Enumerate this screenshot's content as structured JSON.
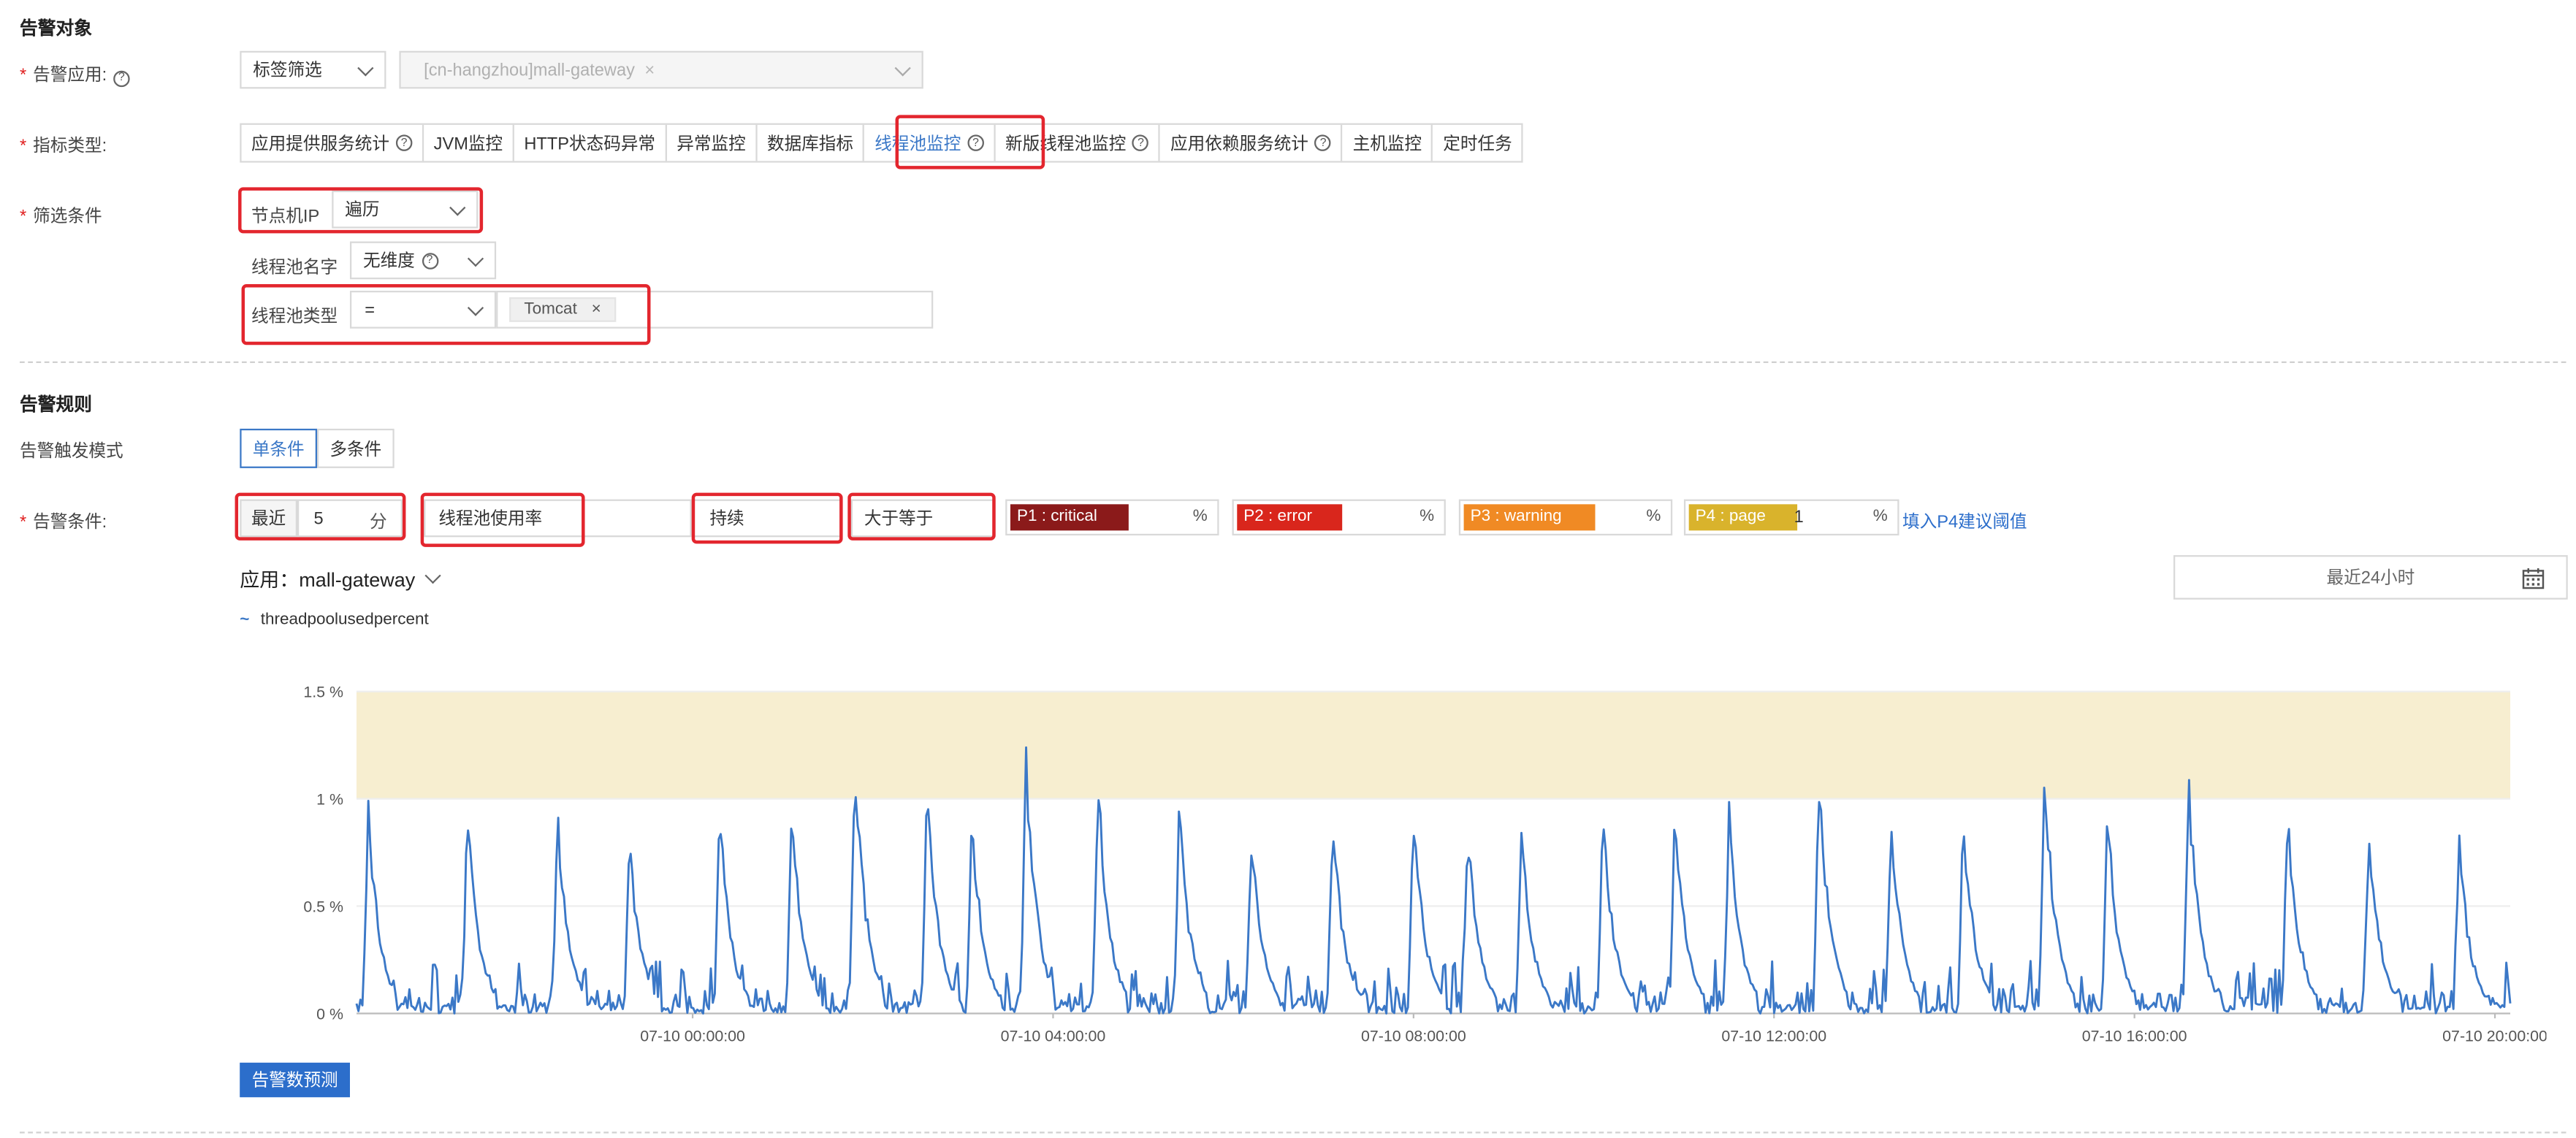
{
  "sections": {
    "target_title": "告警对象",
    "rules_title": "告警规则"
  },
  "target": {
    "app_label": "告警应用:",
    "tag_filter": "标签筛选",
    "app_select": "[cn-hangzhou]mall-gateway",
    "metric_type_label": "指标类型:",
    "metric_tabs": [
      "应用提供服务统计",
      "JVM监控",
      "HTTP状态码异常",
      "异常监控",
      "数据库指标",
      "线程池监控",
      "新版线程池监控",
      "应用依赖服务统计",
      "主机监控",
      "定时任务"
    ],
    "active_tab": "线程池监控",
    "filter_label": "筛选条件",
    "filters": [
      {
        "name": "节点机IP",
        "value": "遍历"
      },
      {
        "name": "线程池名字",
        "value": "无维度"
      },
      {
        "name": "线程池类型",
        "value": "=",
        "tag": "Tomcat"
      }
    ]
  },
  "rules": {
    "trigger_mode_label": "告警触发模式",
    "mode_single": "单条件",
    "mode_multi": "多条件",
    "condition_label": "告警条件:",
    "recent": "最近",
    "recent_value": "5",
    "recent_unit": "分钟",
    "metric": "线程池使用率",
    "duration": "持续",
    "operator": "大于等于",
    "severities": [
      {
        "tag": "P1 : critical",
        "value": "",
        "unit": "%",
        "color": "#8b1a1a"
      },
      {
        "tag": "P2 : error",
        "value": "",
        "unit": "%",
        "color": "#d9261c"
      },
      {
        "tag": "P3 : warning",
        "value": "",
        "unit": "%",
        "color": "#f08a24"
      },
      {
        "tag": "P4 : page",
        "value": "1",
        "unit": "%",
        "color": "#d9b32c"
      }
    ],
    "p4_link": "填入P4建议阈值"
  },
  "chart_header": {
    "app_prefix": "应用：",
    "app_name": "mall-gateway",
    "time_range": "最近24小时"
  },
  "predict_button": "告警数预测",
  "chart_data": {
    "type": "line",
    "series": [
      {
        "name": "threadpoolusedpercent",
        "color": "#3b78c7"
      }
    ],
    "y_ticks": [
      "0 %",
      "0.5 %",
      "1 %",
      "1.5 %"
    ],
    "ylim": [
      0,
      1.5
    ],
    "x_ticks": [
      "07-10 00:00:00",
      "07-10 04:00:00",
      "07-10 08:00:00",
      "07-10 12:00:00",
      "07-10 16:00:00",
      "07-10 20:00:00"
    ],
    "threshold_band": [
      1,
      1.5
    ],
    "band_color": "#f7eed0",
    "spike_hours": [
      -3.6,
      -2.5,
      -1.5,
      -0.7,
      0.3,
      1.1,
      1.8,
      2.6,
      3.1,
      3.7,
      4.5,
      5.4,
      6.2,
      7.1,
      8.0,
      8.6,
      9.2,
      10.1,
      10.9,
      11.5,
      12.5,
      13.3,
      14.1,
      15.0,
      15.7,
      16.6,
      17.7,
      18.6,
      19.6
    ],
    "spike_peaks": [
      1.05,
      1.0,
      0.97,
      0.88,
      1.01,
      0.99,
      1.3,
      1.12,
      0.98,
      1.3,
      1.15,
      1.02,
      0.9,
      1.0,
      1.03,
      0.96,
      0.9,
      1.0,
      1.0,
      1.01,
      1.2,
      0.95,
      1.0,
      1.25,
      1.0,
      1.15,
      1.03,
      0.95,
      0.88
    ],
    "x_start_hour": -3.73,
    "x_end_hour": 20.17
  }
}
